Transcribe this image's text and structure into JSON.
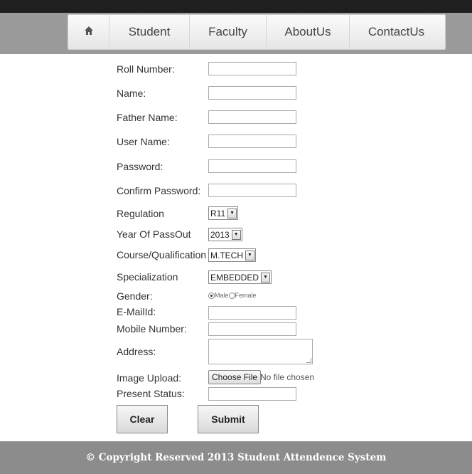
{
  "nav": {
    "home_icon": "home-icon",
    "items": [
      "Student",
      "Faculty",
      "AboutUs",
      "ContactUs"
    ]
  },
  "form": {
    "roll_number": "Roll Number:",
    "name": "Name:",
    "father_name": "Father Name:",
    "user_name": "User Name:",
    "password": "Password:",
    "confirm_password": "Confirm Password:",
    "regulation": "Regulation",
    "regulation_value": "R11",
    "year_of_passout": "Year Of PassOut",
    "year_value": "2013",
    "course": "Course/Qualification",
    "course_value": "M.TECH",
    "specialization": "Specialization",
    "specialization_value": "EMBEDDED",
    "gender": "Gender:",
    "gender_male": "Male",
    "gender_female": "Female",
    "email": "E-MailId:",
    "mobile": "Mobile Number:",
    "address": "Address:",
    "image_upload": "Image Upload:",
    "choose_file": "Choose File",
    "no_file": "No file chosen",
    "present_status": "Present Status:",
    "clear": "Clear",
    "submit": "Submit"
  },
  "footer": {
    "text": "© Copyright Reserved 2013 Student Attendence System"
  }
}
